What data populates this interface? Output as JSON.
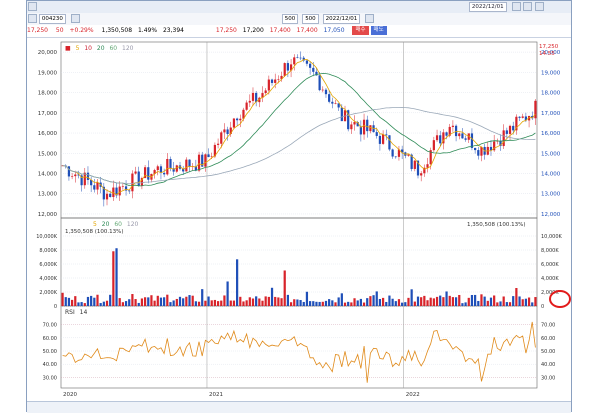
{
  "toolbar": {
    "code": "004230",
    "date": "2022/12/01",
    "price_a": "17,250",
    "change": "50",
    "change_pct": "+0.29%",
    "volume": "1,350,508",
    "vol_pct": "1.49%",
    "amount": "23,394",
    "o_val": "17,250",
    "hl_val": "17,200",
    "h_val": "17,400",
    "l_val": "17,400",
    "c_val": "17,050",
    "step1": "500",
    "step2": "500",
    "buy_label": "매수",
    "sell_label": "매도"
  },
  "price_panel": {
    "ma_labels": [
      "5",
      "10",
      "20",
      "60",
      "120"
    ],
    "y_ticks": [
      "20,000",
      "19,000",
      "18,000",
      "17,000",
      "16,000",
      "15,000",
      "14,000",
      "13,000",
      "12,000"
    ],
    "right_top_label": "17,250",
    "right_top_label2": "14.55"
  },
  "volume_panel": {
    "ma_labels": [
      "5",
      "20",
      "60",
      "120"
    ],
    "left_value": "1,350,508",
    "left_pct": "(100.13%)",
    "right_value": "1,350,508",
    "right_pct": "(100.13%)",
    "y_ticks": [
      "10,000K",
      "8,000K",
      "6,000K",
      "4,000K",
      "2,000K",
      "0"
    ]
  },
  "rsi_panel": {
    "label": "RSI",
    "period": "14",
    "y_ticks": [
      "70.00",
      "60.00",
      "50.00",
      "40.00",
      "30.00"
    ]
  },
  "x_axis": {
    "labels": [
      "2020",
      "2021",
      "2022"
    ]
  },
  "colors": {
    "up": "#d8232a",
    "down": "#1f4fb8",
    "ma5": "#e2a400",
    "ma20": "#2e8b57",
    "ma60": "#9aa8b8",
    "rsi": "#e08a1a",
    "highlight": "#e21b1b"
  }
}
